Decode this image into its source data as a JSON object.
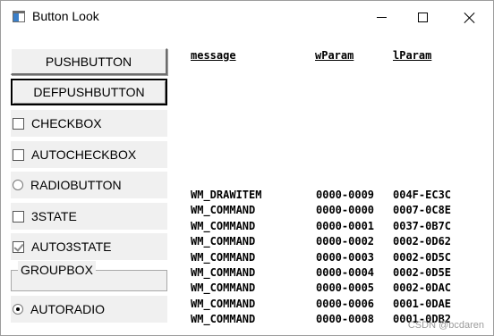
{
  "window": {
    "title": "Button Look"
  },
  "buttons": {
    "pushbutton": "PUSHBUTTON",
    "defpushbutton": "DEFPUSHBUTTON",
    "checkbox": "CHECKBOX",
    "autocheckbox": "AUTOCHECKBOX",
    "radiobutton": "RADIOBUTTON",
    "state3": "3STATE",
    "auto3state": "AUTO3STATE",
    "groupbox": "GROUPBOX",
    "autoradio": "AUTORADIO"
  },
  "control_states": {
    "checkbox": "unchecked",
    "autocheckbox": "unchecked",
    "radiobutton": "unselected",
    "state3": "unchecked",
    "auto3state": "indeterminate",
    "autoradio": "selected"
  },
  "log": {
    "headers": {
      "message": "message",
      "wparam": "wParam",
      "lparam": "lParam"
    },
    "rows": [
      {
        "message": "WM_DRAWITEM",
        "wparam": "0000-0009",
        "lparam": "004F-EC3C"
      },
      {
        "message": "WM_COMMAND",
        "wparam": "0000-0000",
        "lparam": "0007-0C8E"
      },
      {
        "message": "WM_COMMAND",
        "wparam": "0000-0001",
        "lparam": "0037-0B7C"
      },
      {
        "message": "WM_COMMAND",
        "wparam": "0000-0002",
        "lparam": "0002-0D62"
      },
      {
        "message": "WM_COMMAND",
        "wparam": "0000-0003",
        "lparam": "0002-0D5C"
      },
      {
        "message": "WM_COMMAND",
        "wparam": "0000-0004",
        "lparam": "0002-0D5E"
      },
      {
        "message": "WM_COMMAND",
        "wparam": "0000-0005",
        "lparam": "0002-0DAC"
      },
      {
        "message": "WM_COMMAND",
        "wparam": "0000-0006",
        "lparam": "0001-0DAE"
      },
      {
        "message": "WM_COMMAND",
        "wparam": "0000-0008",
        "lparam": "0001-0DB2"
      }
    ]
  },
  "watermark": "CSDN @bcdaren",
  "colors": {
    "control_face": "#f0f0f0",
    "window_bg": "#ffffff",
    "text": "#000000"
  }
}
